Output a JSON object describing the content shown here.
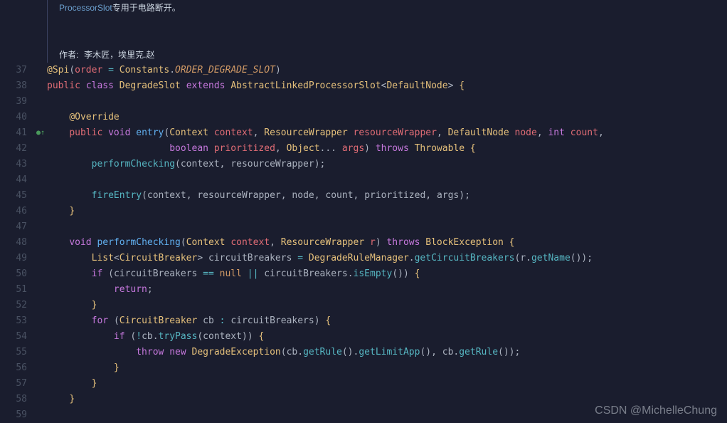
{
  "doc": {
    "summary_link": "ProcessorSlot",
    "summary_text": "专用于电路断开。",
    "author_label": "作者:",
    "author_text": "李木匠，埃里克.赵"
  },
  "lines": {
    "37": {
      "at": "@Spi",
      "order": "order",
      "eq": "=",
      "cls": "Constants",
      "dot": ".",
      "const": "ORDER_DEGRADE_SLOT"
    },
    "38": {
      "public": "public",
      "class": "class",
      "name": "DegradeSlot",
      "extends": "extends",
      "super": "AbstractLinkedProcessorSlot",
      "lt": "<",
      "gen": "DefaultNode",
      "gt": ">",
      "brace": " {"
    },
    "40": {
      "ann": "@Override"
    },
    "41": {
      "public": "public",
      "void": "void",
      "method": "entry",
      "p1t": "Context",
      "p1": "context",
      "p2t": "ResourceWrapper",
      "p2": "resourceWrapper",
      "p3t": "DefaultNode",
      "p3": "node",
      "p4t": "int",
      "p4": "count"
    },
    "42": {
      "p5t": "boolean",
      "p5": "prioritized",
      "p6t": "Object",
      "dots": "...",
      "p6": "args",
      "throws": "throws",
      "exc": "Throwable",
      "brace": " {"
    },
    "43": {
      "call": "performChecking",
      "a1": "context",
      "a2": "resourceWrapper"
    },
    "45": {
      "call": "fireEntry",
      "a1": "context",
      "a2": "resourceWrapper",
      "a3": "node",
      "a4": "count",
      "a5": "prioritized",
      "a6": "args"
    },
    "46": {
      "brace": "}"
    },
    "48": {
      "void": "void",
      "method": "performChecking",
      "p1t": "Context",
      "p1": "context",
      "p2t": "ResourceWrapper",
      "p2": "r",
      "throws": "throws",
      "exc": "BlockException",
      "brace": " {"
    },
    "49": {
      "list": "List",
      "lt": "<",
      "gen": "CircuitBreaker",
      "gt": ">",
      "var": "circuitBreakers",
      "eq": "=",
      "mgr": "DegradeRuleManager",
      "dot": ".",
      "call": "getCircuitBreakers",
      "r": "r",
      "gn": "getName"
    },
    "50": {
      "if": "if",
      "var": "circuitBreakers",
      "eqeq": "==",
      "null": "null",
      "or": "||",
      "var2": "circuitBreakers",
      "isEmpty": "isEmpty",
      "brace": " {"
    },
    "51": {
      "return": "return"
    },
    "52": {
      "brace": "}"
    },
    "53": {
      "for": "for",
      "type": "CircuitBreaker",
      "var": "cb",
      "colon": ":",
      "iter": "circuitBreakers",
      "brace": " {"
    },
    "54": {
      "if": "if",
      "not": "!",
      "cb": "cb",
      "tryPass": "tryPass",
      "ctx": "context",
      "brace": " {"
    },
    "55": {
      "throw": "throw",
      "new": "new",
      "cls": "DegradeException",
      "cb": "cb",
      "getRule": "getRule",
      "getLimitApp": "getLimitApp",
      "cb2": "cb",
      "getRule2": "getRule"
    },
    "56": {
      "brace": "}"
    },
    "57": {
      "brace": "}"
    },
    "58": {
      "brace": "}"
    }
  },
  "gutter": [
    "37",
    "38",
    "39",
    "40",
    "41",
    "42",
    "43",
    "44",
    "45",
    "46",
    "47",
    "48",
    "49",
    "50",
    "51",
    "52",
    "53",
    "54",
    "55",
    "56",
    "57",
    "58",
    "59"
  ],
  "indicator_41": "●↑",
  "watermark": "CSDN @MichelleChung"
}
